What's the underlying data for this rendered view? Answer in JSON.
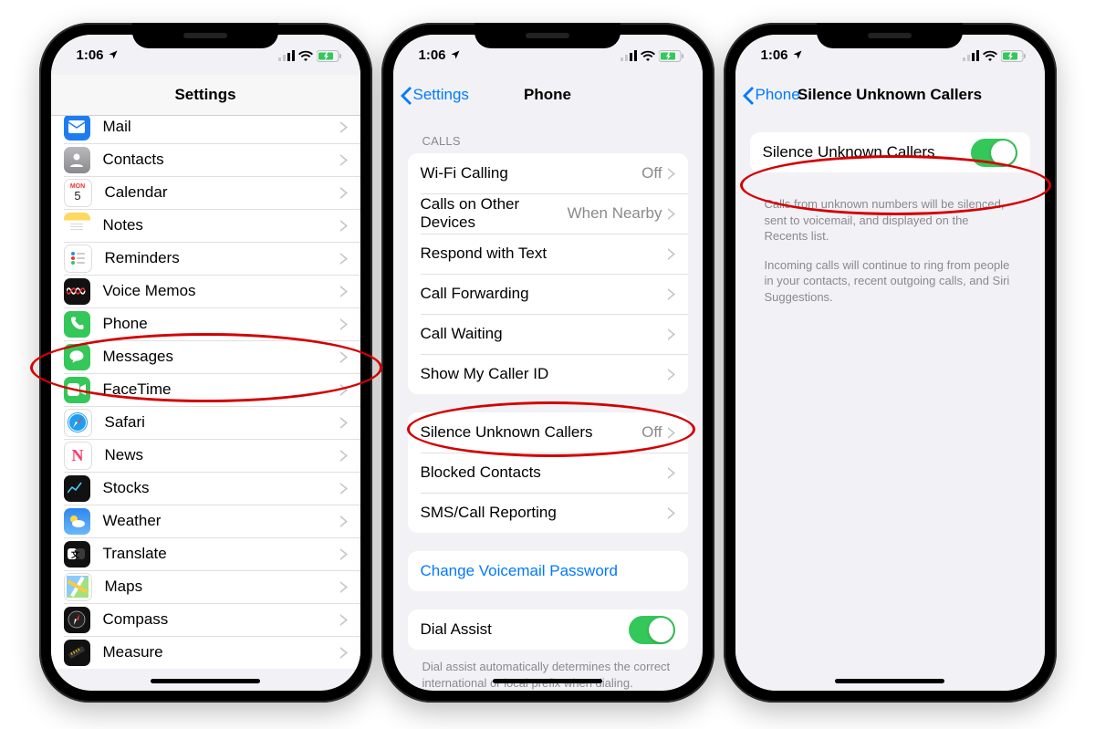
{
  "status": {
    "time": "1:06",
    "battery_color": "#34c759"
  },
  "phone1": {
    "title": "Settings",
    "rows": [
      {
        "icon": "mail-icon",
        "cls": "ic-mail",
        "label": "Mail"
      },
      {
        "icon": "contacts-icon",
        "cls": "ic-contacts",
        "label": "Contacts"
      },
      {
        "icon": "calendar-icon",
        "cls": "ic-calendar",
        "label": "Calendar"
      },
      {
        "icon": "notes-icon",
        "cls": "ic-notes",
        "label": "Notes"
      },
      {
        "icon": "reminders-icon",
        "cls": "ic-reminders",
        "label": "Reminders"
      },
      {
        "icon": "voice-memos-icon",
        "cls": "ic-voice",
        "label": "Voice Memos"
      },
      {
        "icon": "phone-icon",
        "cls": "ic-phone",
        "label": "Phone"
      },
      {
        "icon": "messages-icon",
        "cls": "ic-messages",
        "label": "Messages"
      },
      {
        "icon": "facetime-icon",
        "cls": "ic-facetime",
        "label": "FaceTime"
      },
      {
        "icon": "safari-icon",
        "cls": "ic-safari",
        "label": "Safari"
      },
      {
        "icon": "news-icon",
        "cls": "ic-news",
        "label": "News"
      },
      {
        "icon": "stocks-icon",
        "cls": "ic-stocks",
        "label": "Stocks"
      },
      {
        "icon": "weather-icon",
        "cls": "ic-weather",
        "label": "Weather"
      },
      {
        "icon": "translate-icon",
        "cls": "ic-translate",
        "label": "Translate"
      },
      {
        "icon": "maps-icon",
        "cls": "ic-maps",
        "label": "Maps"
      },
      {
        "icon": "compass-icon",
        "cls": "ic-compass",
        "label": "Compass"
      },
      {
        "icon": "measure-icon",
        "cls": "ic-measure",
        "label": "Measure"
      }
    ]
  },
  "phone2": {
    "back": "Settings",
    "title": "Phone",
    "section_calls": "CALLS",
    "calls": [
      {
        "label": "Wi-Fi Calling",
        "detail": "Off"
      },
      {
        "label": "Calls on Other Devices",
        "detail": "When Nearby"
      },
      {
        "label": "Respond with Text",
        "detail": ""
      },
      {
        "label": "Call Forwarding",
        "detail": ""
      },
      {
        "label": "Call Waiting",
        "detail": ""
      },
      {
        "label": "Show My Caller ID",
        "detail": ""
      }
    ],
    "group2": [
      {
        "label": "Silence Unknown Callers",
        "detail": "Off"
      },
      {
        "label": "Blocked Contacts",
        "detail": ""
      },
      {
        "label": "SMS/Call Reporting",
        "detail": ""
      }
    ],
    "voicemail_link": "Change Voicemail Password",
    "dial_assist": "Dial Assist",
    "dial_assist_note": "Dial assist automatically determines the correct international or local prefix when dialing."
  },
  "phone3": {
    "back": "Phone",
    "title": "Silence Unknown Callers",
    "row_label": "Silence Unknown Callers",
    "note1": "Calls from unknown numbers will be silenced, sent to voicemail, and displayed on the Recents list.",
    "note2": "Incoming calls will continue to ring from people in your contacts, recent outgoing calls, and Siri Suggestions."
  }
}
